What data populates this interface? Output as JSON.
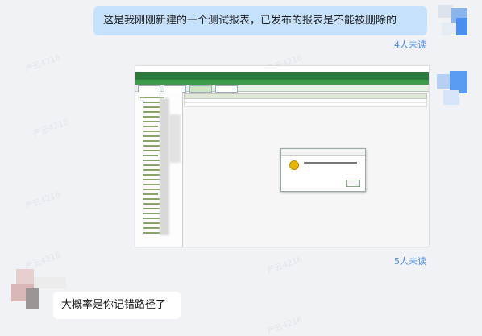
{
  "messages": {
    "first": {
      "text": "这是我刚刚新建的一个测试报表，已发布的报表是不能被删除的",
      "read_status": "4人未读"
    },
    "second": {
      "read_status": "5人未读"
    },
    "reply": {
      "text": "大概率是你记错路径了"
    }
  },
  "watermark": "严云4216",
  "colors": {
    "my_bubble": "#c6e1fb",
    "read_status": "#4a8ce6",
    "app_green": "#2c7a3b",
    "dialog_icon": "#e8b400"
  },
  "icons": {
    "dialog": "info-warning-icon"
  }
}
